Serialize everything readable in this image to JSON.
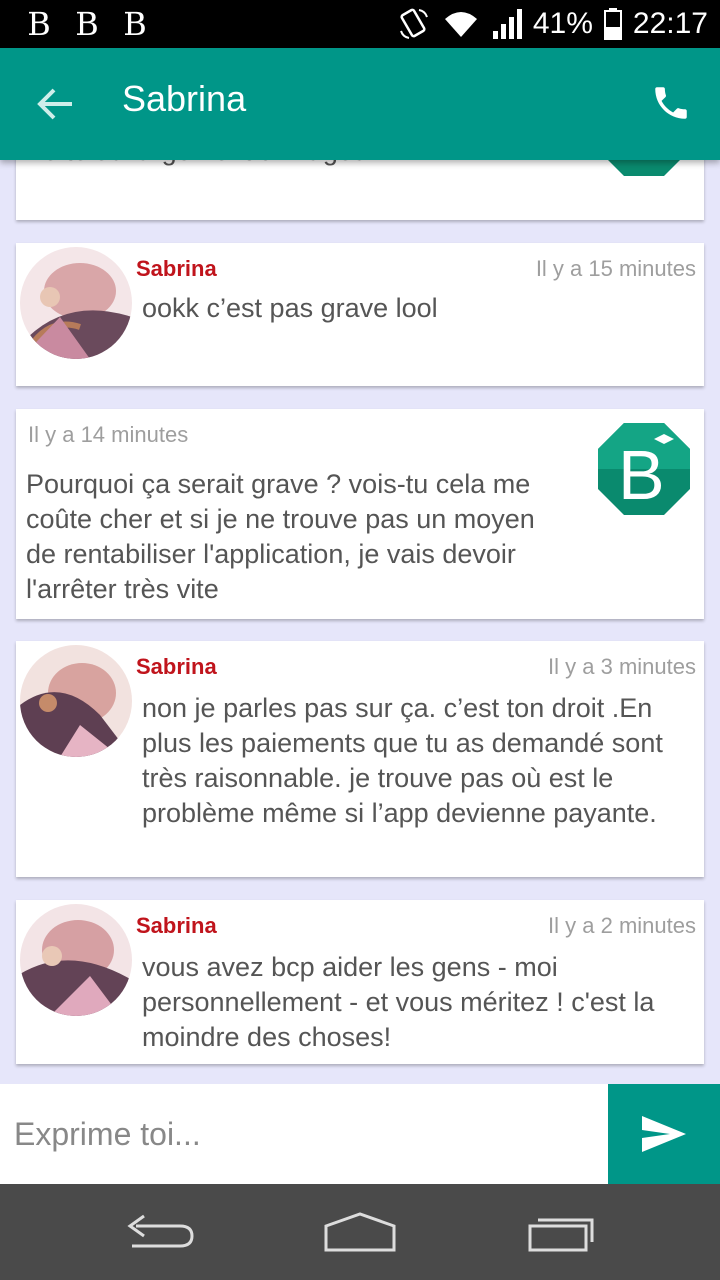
{
  "status_bar": {
    "notification_icons": [
      "B",
      "B",
      "B"
    ],
    "icons": [
      "rotate-icon",
      "wifi-icon",
      "signal-icon",
      "battery-icon"
    ],
    "battery": "41%",
    "time": "22:17"
  },
  "app_bar": {
    "title": "Sabrina",
    "back_icon": "arrow-back-icon",
    "call_icon": "phone-icon",
    "color": "#009688"
  },
  "messages": [
    {
      "partial": true,
      "text": "Le téléchargement d'images"
    },
    {
      "sender": "Sabrina",
      "time": "Il y a 15 minutes",
      "text": "ookk c’est pas grave lool"
    },
    {
      "sender": "",
      "time": "Il y a 14 minutes",
      "text": "Pourquoi ça serait grave ? vois-tu cela me coûte cher et si je ne trouve pas un moyen de rentabiliser l'application, je vais devoir l'arrêter très vite"
    },
    {
      "sender": "Sabrina",
      "time": "Il y a 3 minutes",
      "text": "non je parles pas sur ça. c’est ton droit .En  plus les  paiements que tu as demandé sont très raisonnable. je trouve pas où est le problème même si l’app devienne payante."
    },
    {
      "sender": "Sabrina",
      "time": "Il y a 2 minutes",
      "text": "vous avez bcp aider les gens - moi personnellement - et vous méritez ! c'est la moindre des choses!"
    }
  ],
  "composer": {
    "placeholder": "Exprime toi...",
    "send_icon": "send-icon"
  },
  "nav_bar": {
    "icons": [
      "back-nav-icon",
      "home-nav-icon",
      "recents-nav-icon"
    ]
  },
  "colors": {
    "accent": "#009688",
    "sender": "#c0141c",
    "background": "#e6e6fa"
  }
}
